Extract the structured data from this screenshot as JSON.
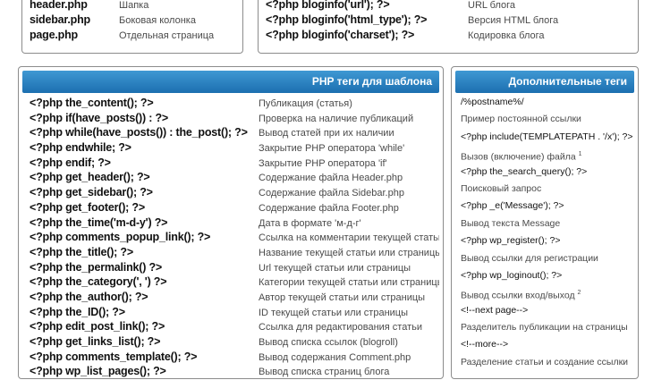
{
  "files": [
    {
      "code": "header.php",
      "desc": "Шапка"
    },
    {
      "code": "sidebar.php",
      "desc": "Боковая колонка"
    },
    {
      "code": "page.php",
      "desc": "Отдельная страница"
    }
  ],
  "bloginfo": [
    {
      "code": "<?php bloginfo('url'); ?>",
      "desc": "URL блога"
    },
    {
      "code": "<?php bloginfo('html_type'); ?>",
      "desc": "Версия HTML блога"
    },
    {
      "code": "<?php bloginfo('charset'); ?>",
      "desc": "Кодировка блога"
    }
  ],
  "php_section": {
    "title": "PHP теги для шаблона",
    "rows": [
      {
        "code": "<?php the_content(); ?>",
        "desc": "Публикация (статья)"
      },
      {
        "code": "<?php if(have_posts()) : ?>",
        "desc": "Проверка на наличие публикаций"
      },
      {
        "code": "<?php while(have_posts()) : the_post(); ?>",
        "desc": "Вывод статей при их наличии"
      },
      {
        "code": "<?php endwhile; ?>",
        "desc": "Закрытие PHP оператора 'while'"
      },
      {
        "code": "<?php endif; ?>",
        "desc": "Закрытие PHP оператора 'if'"
      },
      {
        "code": "<?php get_header(); ?>",
        "desc": "Содержание файла Header.php"
      },
      {
        "code": "<?php get_sidebar(); ?>",
        "desc": "Содержание файла Sidebar.php"
      },
      {
        "code": "<?php get_footer(); ?>",
        "desc": "Содержание файла Footer.php"
      },
      {
        "code": "<?php the_time('m-d-y') ?>",
        "desc": "Дата в формате 'м-д-г'"
      },
      {
        "code": "<?php comments_popup_link(); ?>",
        "desc": "Ссылка на комментарии текущей статьи"
      },
      {
        "code": "<?php the_title(); ?>",
        "desc": "Название текущей статьи или страницы"
      },
      {
        "code": "<?php the_permalink() ?>",
        "desc": "Url текущей статьи или страницы"
      },
      {
        "code": "<?php the_category(', ') ?>",
        "desc": "Категории текущей статьи или страницы"
      },
      {
        "code": "<?php the_author(); ?>",
        "desc": "Автор текущей статьи или страницы"
      },
      {
        "code": "<?php the_ID(); ?>",
        "desc": "ID текущей статьи или страницы"
      },
      {
        "code": "<?php edit_post_link(); ?>",
        "desc": "Ссылка для редактирования статьи"
      },
      {
        "code": "<?php get_links_list(); ?>",
        "desc": "Вывод списка ссылок (blogroll)"
      },
      {
        "code": "<?php comments_template(); ?>",
        "desc": "Вывод содержания Comment.php"
      },
      {
        "code": "<?php wp_list_pages(); ?>",
        "desc": "Вывод списка страниц блога"
      }
    ]
  },
  "extra_section": {
    "title": "Дополнительные теги",
    "lines": [
      {
        "kind": "code",
        "text": "/%postname%/"
      },
      {
        "kind": "desc",
        "text": "Пример постоянной ссылки"
      },
      {
        "kind": "code",
        "text": "<?php include(TEMPLATEPATH . '/x'); ?>"
      },
      {
        "kind": "desc",
        "text": "Вызов (включение) файла",
        "note": "1"
      },
      {
        "kind": "code",
        "text": "<?php the_search_query(); ?>"
      },
      {
        "kind": "desc",
        "text": "Поисковый запрос"
      },
      {
        "kind": "code",
        "text": "<?php _e('Message'); ?>"
      },
      {
        "kind": "desc",
        "text": "Вывод текста Message"
      },
      {
        "kind": "code",
        "text": "<?php wp_register(); ?>"
      },
      {
        "kind": "desc",
        "text": "Вывод ссылки для регистрации"
      },
      {
        "kind": "code",
        "text": "<?php wp_loginout(); ?>"
      },
      {
        "kind": "desc",
        "text": "Вывод ссылки вход/выход",
        "note": "2"
      },
      {
        "kind": "code",
        "text": "<!--next page-->"
      },
      {
        "kind": "desc",
        "text": "Разделитель публикации на страницы"
      },
      {
        "kind": "code",
        "text": "<!--more-->"
      },
      {
        "kind": "desc",
        "text": "Разделение статьи и создание ссылки"
      }
    ]
  },
  "colors": {
    "header_top": "#3f98d3",
    "header_bottom": "#1c6fb0",
    "border": "#8c8c8c"
  }
}
